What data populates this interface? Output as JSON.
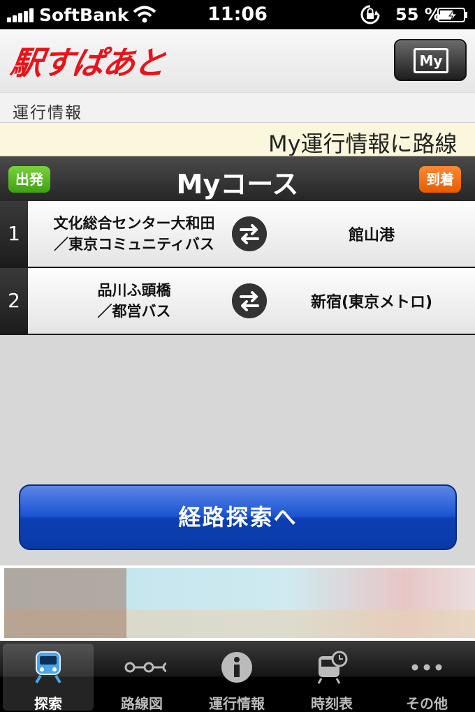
{
  "status_bar": {
    "carrier": "SoftBank",
    "time": "11:06",
    "battery": "55 %"
  },
  "header": {
    "logo": "駅すぱあと",
    "my_button": "My"
  },
  "section_label": "運行情報",
  "ticker_text": "My運行情報に路線",
  "my_course": {
    "title": "Myコース",
    "departure_badge": "出発",
    "arrival_badge": "到着",
    "courses": [
      {
        "number": "1",
        "from_line1": "文化総合センター大和田",
        "from_line2": "／東京コミュニティバス",
        "to": "館山港"
      },
      {
        "number": "2",
        "from_line1": "品川ふ頭橋",
        "from_line2": "／都営バス",
        "to": "新宿(東京メトロ)"
      }
    ]
  },
  "route_search_button": "経路探索へ",
  "tabs": [
    {
      "label": "探索",
      "icon": "train-icon"
    },
    {
      "label": "路線図",
      "icon": "route-map-icon"
    },
    {
      "label": "運行情報",
      "icon": "info-icon"
    },
    {
      "label": "時刻表",
      "icon": "timetable-icon"
    },
    {
      "label": "その他",
      "icon": "more-icon"
    }
  ],
  "colors": {
    "brand_red": "#e8141b",
    "departure_green": "#3ea111",
    "arrival_orange": "#e85b00",
    "button_blue": "#1a54d3",
    "active_tab_blue": "#4aa6e8"
  }
}
